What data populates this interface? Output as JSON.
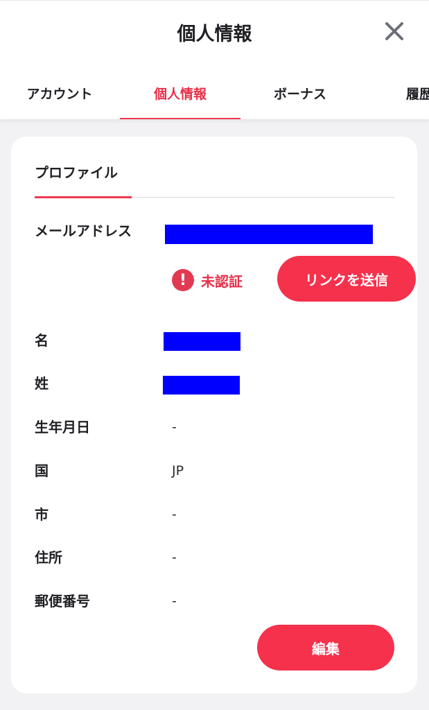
{
  "header": {
    "title": "個人情報",
    "close_icon": "close-icon"
  },
  "tabs": [
    {
      "label": "アカウント",
      "active": false
    },
    {
      "label": "個人情報",
      "active": true
    },
    {
      "label": "ボーナス",
      "active": false
    },
    {
      "label": "履歴",
      "active": false
    }
  ],
  "profile": {
    "section_tab": "プロファイル",
    "fields": {
      "email": {
        "label": "メールアドレス",
        "value": "(redacted)"
      },
      "first_name": {
        "label": "名",
        "value": "(redacted)"
      },
      "last_name": {
        "label": "姓",
        "value": "(redacted)"
      },
      "birthdate": {
        "label": "生年月日",
        "value": "-"
      },
      "country": {
        "label": "国",
        "value": "JP"
      },
      "city": {
        "label": "市",
        "value": "-"
      },
      "address": {
        "label": "住所",
        "value": "-"
      },
      "postal_code": {
        "label": "郵便番号",
        "value": "-"
      }
    },
    "email_status": {
      "icon": "exclamation-icon",
      "text": "未認証"
    },
    "send_link_label": "リンクを送信",
    "edit_label": "編集"
  },
  "colors": {
    "accent": "#f5314c",
    "accent_text": "#e8304a",
    "redaction": "#0000ff",
    "background": "#f2f2f4"
  }
}
